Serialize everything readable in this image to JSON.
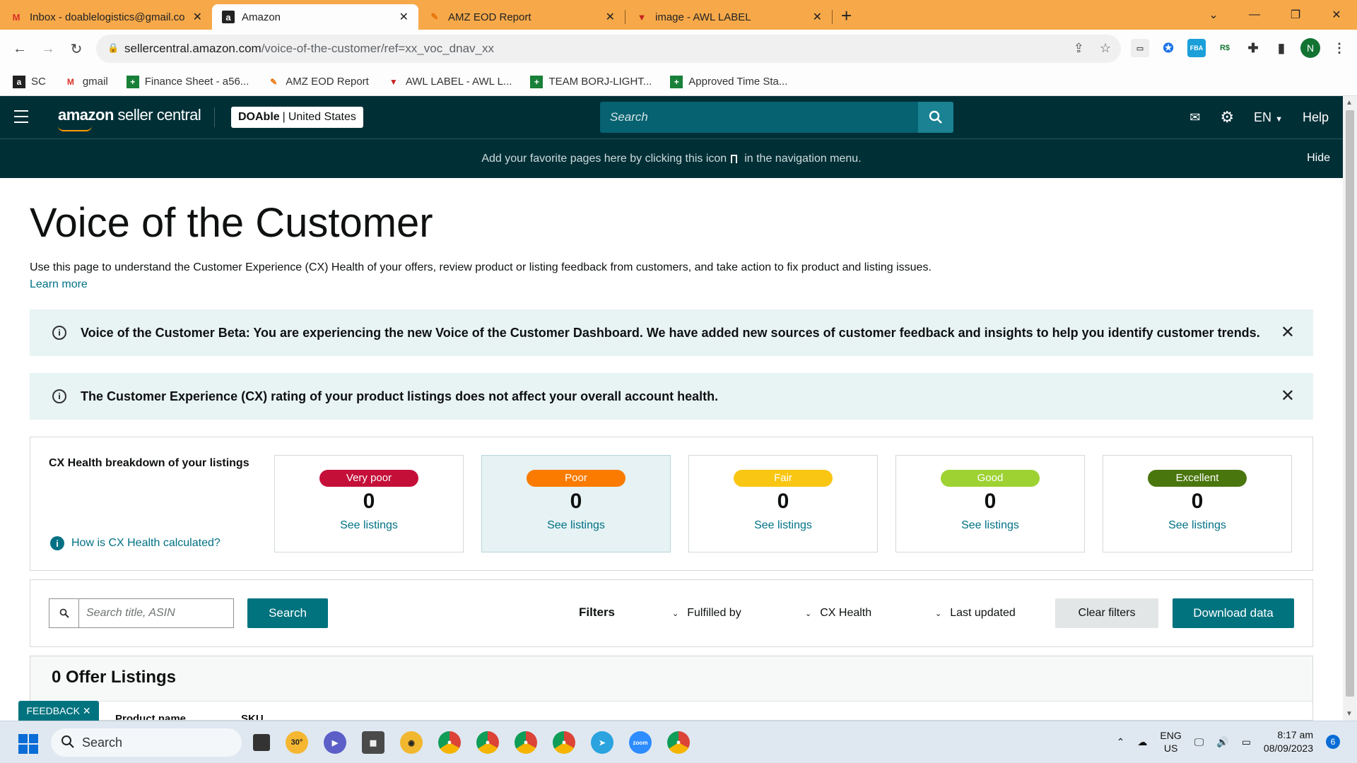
{
  "browser": {
    "tabs": [
      {
        "title": "Inbox - doablelogistics@gmail.co",
        "icon": "gmail-icon",
        "active": false
      },
      {
        "title": "Amazon",
        "icon": "amazon-icon",
        "active": true
      },
      {
        "title": "AMZ EOD Report",
        "icon": "feather-icon",
        "active": false
      },
      {
        "title": "image - AWL LABEL",
        "icon": "awl-icon",
        "active": false
      }
    ],
    "url_host": "sellercentral.amazon.com",
    "url_path": "/voice-of-the-customer/ref=xx_voc_dnav_xx",
    "profile_initial": "N",
    "bookmarks": [
      {
        "label": "SC",
        "icon": "amazon-icon"
      },
      {
        "label": "gmail",
        "icon": "gmail-icon"
      },
      {
        "label": "Finance Sheet - a56...",
        "icon": "sheets-icon"
      },
      {
        "label": "AMZ EOD Report",
        "icon": "feather-icon"
      },
      {
        "label": "AWL LABEL - AWL L...",
        "icon": "awl-icon"
      },
      {
        "label": "TEAM BORJ-LIGHT...",
        "icon": "sheets-icon"
      },
      {
        "label": "Approved Time Sta...",
        "icon": "sheets-icon"
      }
    ]
  },
  "header": {
    "logo_main": "amazon",
    "logo_sub": "seller central",
    "account_name": "DOAble",
    "account_region": "United States",
    "search_placeholder": "Search",
    "lang": "EN",
    "help": "Help"
  },
  "fav_bar": {
    "text_before": "Add your favorite pages here by clicking this icon",
    "text_after": "in the navigation menu.",
    "hide": "Hide"
  },
  "page": {
    "title": "Voice of the Customer",
    "description": "Use this page to understand the Customer Experience (CX) Health of your offers, review product or listing feedback from customers, and take action to fix product and listing issues.",
    "learn_more": "Learn more"
  },
  "alerts": [
    {
      "text": "Voice of the Customer Beta: You are experiencing the new Voice of the Customer Dashboard. We have added new sources of customer feedback and insights to help you identify customer trends."
    },
    {
      "text": "The Customer Experience (CX) rating of your product listings does not affect your overall account health."
    }
  ],
  "cx_health": {
    "label": "CX Health breakdown of your listings",
    "how_link": "How is CX Health calculated?",
    "tiles": [
      {
        "rating": "Very poor",
        "count": "0",
        "link": "See listings",
        "color": "#c40f39"
      },
      {
        "rating": "Poor",
        "count": "0",
        "link": "See listings",
        "color": "#fa7b00"
      },
      {
        "rating": "Fair",
        "count": "0",
        "link": "See listings",
        "color": "#f9c613"
      },
      {
        "rating": "Good",
        "count": "0",
        "link": "See listings",
        "color": "#9dd232"
      },
      {
        "rating": "Excellent",
        "count": "0",
        "link": "See listings",
        "color": "#4a760e"
      }
    ]
  },
  "filters": {
    "search_placeholder": "Search title, ASIN",
    "search_button": "Search",
    "filters_label": "Filters",
    "dropdowns": [
      "Fulfilled by",
      "CX Health",
      "Last updated"
    ],
    "clear": "Clear filters",
    "download": "Download data"
  },
  "listings": {
    "heading": "0 Offer Listings",
    "columns": [
      "Product name",
      "SKU"
    ]
  },
  "feedback": "FEEDBACK",
  "taskbar": {
    "search": "Search",
    "weather_temp": "30°",
    "lang_top": "ENG",
    "lang_bottom": "US",
    "time": "8:17 am",
    "date": "08/09/2023",
    "notifications": "6"
  },
  "colors": {
    "header_bg": "#002f36",
    "teal_button": "#00737f",
    "link": "#007185",
    "alert_bg": "#e8f3f4",
    "tab_bar": "#f7a94a"
  }
}
